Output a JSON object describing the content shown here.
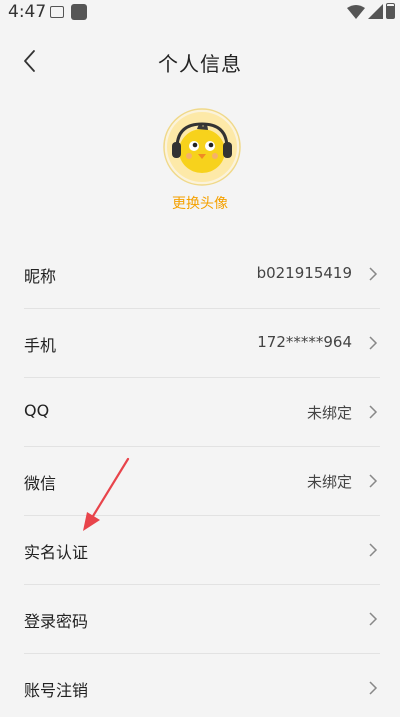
{
  "status_bar": {
    "time": "4:47",
    "icons": [
      "image-icon",
      "app-square-icon",
      "wifi-icon",
      "signal-icon",
      "battery-icon"
    ]
  },
  "header": {
    "title": "个人信息",
    "back_icon": "back-chevron-icon"
  },
  "avatar": {
    "icon": "chick-with-headphones-avatar",
    "change_label": "更换头像"
  },
  "colors": {
    "accent": "#f5a100",
    "background": "#f4f4f4",
    "annotation_arrow": "#e8444b"
  },
  "rows": [
    {
      "label": "昵称",
      "value": "b021915419"
    },
    {
      "label": "手机",
      "value": "172*****964"
    },
    {
      "label": "QQ",
      "value": "未绑定"
    },
    {
      "label": "微信",
      "value": "未绑定"
    },
    {
      "label": "实名认证",
      "value": ""
    },
    {
      "label": "登录密码",
      "value": ""
    },
    {
      "label": "账号注销",
      "value": ""
    }
  ]
}
